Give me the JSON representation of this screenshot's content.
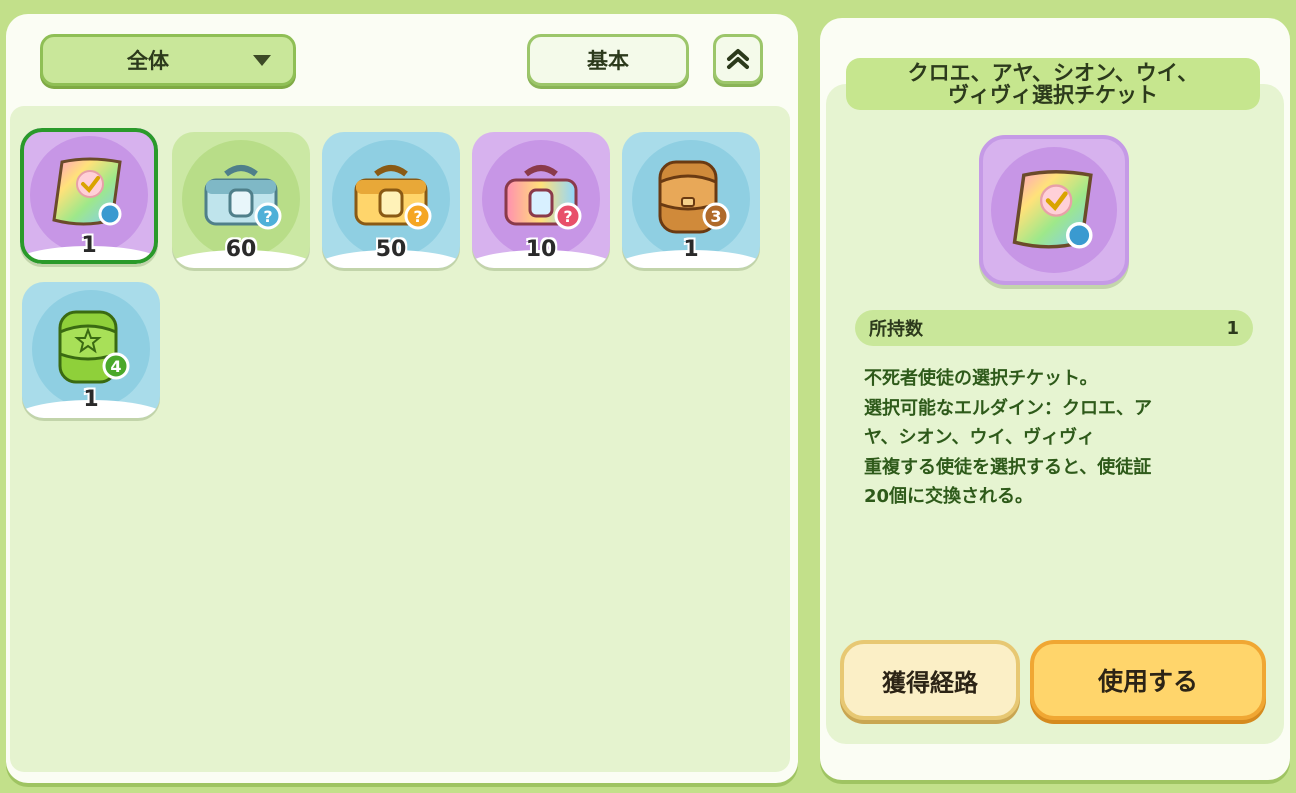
{
  "inventory": {
    "filter_label": "全体",
    "sort_label": "基本",
    "items": [
      {
        "icon": "rainbow-ticket",
        "count": "1",
        "color": "purple",
        "selected": true
      },
      {
        "icon": "silver-toolbox",
        "count": "60",
        "color": "green",
        "selected": false
      },
      {
        "icon": "gold-toolbox",
        "count": "50",
        "color": "blue",
        "selected": false
      },
      {
        "icon": "rainbow-toolbox",
        "count": "10",
        "color": "purple",
        "selected": false
      },
      {
        "icon": "brown-backpack",
        "count": "1",
        "color": "blue",
        "selected": false,
        "badge": "3"
      },
      {
        "icon": "green-backpack",
        "count": "1",
        "color": "blue",
        "selected": false,
        "badge": "4"
      }
    ]
  },
  "detail": {
    "title_line1": "クロエ、アヤ、シオン、ウイ、",
    "title_line2": "ヴィヴィ選択チケット",
    "owned_label": "所持数",
    "owned_value": "1",
    "description_lines": [
      "不死者使徒の選択チケット。",
      "選択可能なエルダイン：クロエ、ア",
      "ヤ、シオン、ウイ、ヴィヴィ",
      "重複する使徒を選択すると、使徒証",
      "20個に交換される。"
    ],
    "source_button": "獲得経路",
    "use_button": "使用する"
  },
  "colors": {
    "background": "#c2e08a",
    "selected_border": "#2a9a2a",
    "use_button": "#ffd56b"
  }
}
